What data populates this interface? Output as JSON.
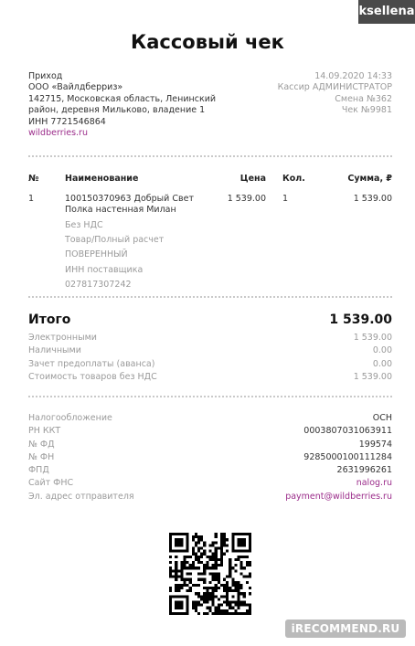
{
  "user_tag": "ksellena",
  "title": "Кассовый чек",
  "header": {
    "left_lines": [
      "Приход",
      "ООО «Вайлдберриз»",
      "142715, Московская область, Ленинский",
      "район, деревня Мильково, владение 1",
      "ИНН 7721546864"
    ],
    "website": "wildberries.ru",
    "right_lines": [
      "14.09.2020 14:33",
      "Кассир АДМИНИСТРАТОР",
      "Смена №362",
      "Чек №9981"
    ]
  },
  "table": {
    "headers": {
      "num": "№",
      "name": "Наименование",
      "price": "Цена",
      "qty": "Кол.",
      "sum": "Сумма, ₽"
    },
    "rows": [
      {
        "num": "1",
        "name_lines": [
          "100150370963 Добрый Свет",
          "Полка настенная Милан"
        ],
        "details": [
          "Без НДС",
          "Товар/Полный расчет",
          "ПОВЕРЕННЫЙ",
          "ИНН поставщика",
          "027817307242"
        ],
        "price": "1 539.00",
        "qty": "1",
        "sum": "1 539.00"
      }
    ]
  },
  "total": {
    "label": "Итого",
    "value": "1 539.00"
  },
  "payments": [
    {
      "label": "Электронными",
      "value": "1 539.00"
    },
    {
      "label": "Наличными",
      "value": "0.00"
    },
    {
      "label": "Зачет предоплаты (аванса)",
      "value": "0.00"
    },
    {
      "label": "Стоимость товаров без НДС",
      "value": "1 539.00"
    }
  ],
  "fiscal": [
    {
      "label": "Налогообложение",
      "value": "ОСН"
    },
    {
      "label": "РН ККТ",
      "value": "0003807031063911"
    },
    {
      "label": "№ ФД",
      "value": "199574"
    },
    {
      "label": "№ ФН",
      "value": "9285000100111284"
    },
    {
      "label": "ФПД",
      "value": "2631996261"
    },
    {
      "label": "Сайт ФНС",
      "value": "nalog.ru",
      "link": true
    },
    {
      "label": "Эл. адрес отправителя",
      "value": "payment@wildberries.ru",
      "link": true
    }
  ],
  "watermark": "iRECOMMEND.RU",
  "colors": {
    "link": "#9b2c8a",
    "muted": "#9a9a9a",
    "text": "#222222"
  }
}
